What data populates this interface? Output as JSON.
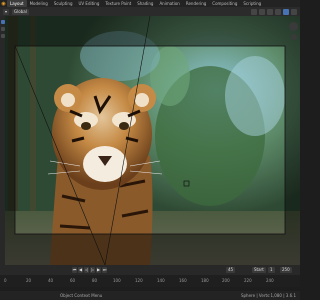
{
  "app": {
    "name": "Blender"
  },
  "workspaces": [
    "Layout",
    "Modeling",
    "Sculpting",
    "UV Editing",
    "Texture Paint",
    "Shading",
    "Animation",
    "Rendering",
    "Compositing",
    "Scripting"
  ],
  "active_workspace": "Layout",
  "header": {
    "view_mode": "Global"
  },
  "timeline": {
    "current_frame": "45",
    "start_label": "Start",
    "start_value": "1",
    "end_label": "End",
    "end_value": "250",
    "ruler_ticks": [
      "0",
      "20",
      "40",
      "60",
      "80",
      "100",
      "120",
      "140",
      "160",
      "180",
      "200",
      "220",
      "240"
    ]
  },
  "status": {
    "left": "Object Context Menu",
    "right": "Sphere | Verts:1,080 | 3.6.1"
  },
  "colors": {
    "accent": "#4772b3",
    "logo": "#f5a623"
  }
}
